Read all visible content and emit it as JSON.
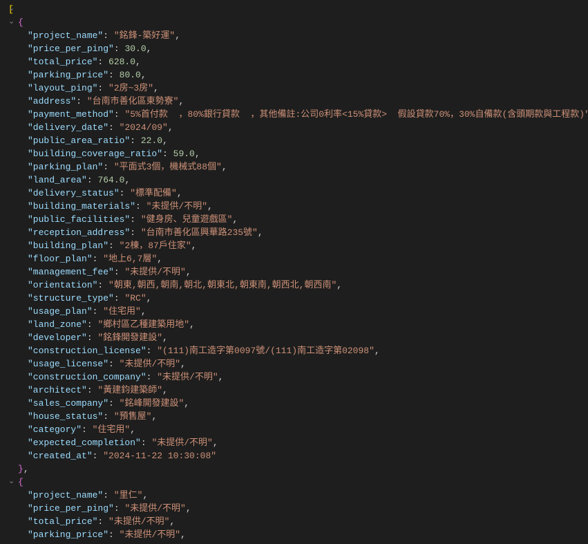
{
  "toggle1": "⌄",
  "toggle2": "⌄",
  "toggle3": "⌄",
  "open_bracket": "[",
  "open_brace": "{",
  "close_brace_comma": "},",
  "entries1": [
    {
      "key": "project_name",
      "val": "銘鋒-築好運",
      "type": "string"
    },
    {
      "key": "price_per_ping",
      "val": "30.0",
      "type": "number"
    },
    {
      "key": "total_price",
      "val": "628.0",
      "type": "number"
    },
    {
      "key": "parking_price",
      "val": "80.0",
      "type": "number"
    },
    {
      "key": "layout_ping",
      "val": "2房~3房",
      "type": "string"
    },
    {
      "key": "address",
      "val": "台南市善化區東勢寮",
      "type": "string"
    },
    {
      "key": "payment_method",
      "val": "5%首付款  ，80%銀行貸款  ，其他備註:公司0利率<15%貸款>  假設貸款70%，30%自備款(含頭期款與工程款)",
      "type": "string"
    },
    {
      "key": "delivery_date",
      "val": "2024/09",
      "type": "string"
    },
    {
      "key": "public_area_ratio",
      "val": "22.0",
      "type": "number"
    },
    {
      "key": "building_coverage_ratio",
      "val": "59.0",
      "type": "number"
    },
    {
      "key": "parking_plan",
      "val": "平面式3個，機械式88個",
      "type": "string"
    },
    {
      "key": "land_area",
      "val": "764.0",
      "type": "number"
    },
    {
      "key": "delivery_status",
      "val": "標準配備",
      "type": "string"
    },
    {
      "key": "building_materials",
      "val": "未提供/不明",
      "type": "string"
    },
    {
      "key": "public_facilities",
      "val": "健身房、兒童遊戲區",
      "type": "string"
    },
    {
      "key": "reception_address",
      "val": "台南市善化區興華路235號",
      "type": "string"
    },
    {
      "key": "building_plan",
      "val": "2棟，87戶住家",
      "type": "string"
    },
    {
      "key": "floor_plan",
      "val": "地上6,7層",
      "type": "string"
    },
    {
      "key": "management_fee",
      "val": "未提供/不明",
      "type": "string"
    },
    {
      "key": "orientation",
      "val": "朝東,朝西,朝南,朝北,朝東北,朝東南,朝西北,朝西南",
      "type": "string"
    },
    {
      "key": "structure_type",
      "val": "RC",
      "type": "string"
    },
    {
      "key": "usage_plan",
      "val": "住宅用",
      "type": "string"
    },
    {
      "key": "land_zone",
      "val": "鄉村區乙種建築用地",
      "type": "string"
    },
    {
      "key": "developer",
      "val": "銘鋒開發建設",
      "type": "string"
    },
    {
      "key": "construction_license",
      "val": "(111)南工造字第0097號/(111)南工造字第02098",
      "type": "string"
    },
    {
      "key": "usage_license",
      "val": "未提供/不明",
      "type": "string"
    },
    {
      "key": "construction_company",
      "val": "未提供/不明",
      "type": "string"
    },
    {
      "key": "architect",
      "val": "黃建鈞建築師",
      "type": "string"
    },
    {
      "key": "sales_company",
      "val": "銘峰開發建設",
      "type": "string"
    },
    {
      "key": "house_status",
      "val": "預售屋",
      "type": "string"
    },
    {
      "key": "category",
      "val": "住宅用",
      "type": "string"
    },
    {
      "key": "expected_completion",
      "val": "未提供/不明",
      "type": "string"
    },
    {
      "key": "created_at",
      "val": "2024-11-22 10:30:08",
      "type": "string"
    }
  ],
  "entries2": [
    {
      "key": "project_name",
      "val": "里仁",
      "type": "string"
    },
    {
      "key": "price_per_ping",
      "val": "未提供/不明",
      "type": "string"
    },
    {
      "key": "total_price",
      "val": "未提供/不明",
      "type": "string"
    },
    {
      "key": "parking_price",
      "val": "未提供/不明",
      "type": "string"
    }
  ]
}
